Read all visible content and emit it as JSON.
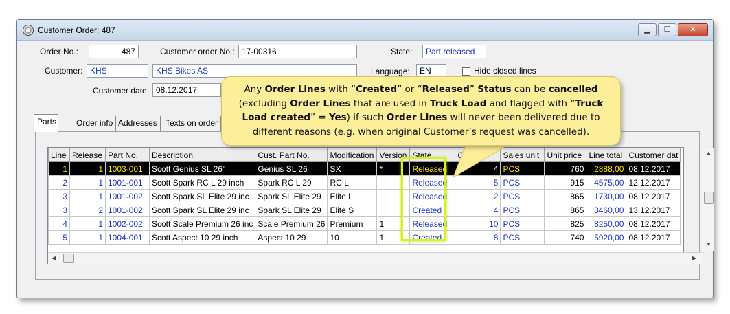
{
  "window": {
    "title": "Customer Order: 487"
  },
  "header": {
    "order_no_label": "Order No.:",
    "order_no": "487",
    "customer_order_no_label": "Customer order No.:",
    "customer_order_no": "17-00316",
    "state_label": "State:",
    "state": "Part.released",
    "customer_label": "Customer:",
    "customer_code": "KHS",
    "customer_name": "KHS Bikes AS",
    "language_label": "Language:",
    "language": "EN",
    "hide_closed_label": "Hide closed lines",
    "customer_date_label": "Customer date:",
    "customer_date": "08.12.2017"
  },
  "tabs": [
    "Parts",
    "Order info",
    "Addresses",
    "Texts on order"
  ],
  "grid": {
    "columns": [
      "Line",
      "Release",
      "Part No.",
      "Description",
      "Cust. Part No.",
      "Modification",
      "Version",
      "State",
      "Qty",
      "Sales unit",
      "Unit price",
      "Line total",
      "Customer dat"
    ],
    "rows": [
      {
        "line": "1",
        "release": "1",
        "part_no": "1003-001",
        "description": "Scott Genius SL 26\"",
        "cust_part_no": "Genius SL 26",
        "modification": "SX",
        "version": "*",
        "state": "Released",
        "qty": "4",
        "unit": "PCS",
        "unit_price": "760",
        "line_total": "2888,00",
        "customer_date": "08.12.2017"
      },
      {
        "line": "2",
        "release": "1",
        "part_no": "1001-001",
        "description": "Scott Spark RC L 29 inch",
        "cust_part_no": "Spark RC L 29",
        "modification": "RC L",
        "version": "",
        "state": "Released",
        "qty": "5",
        "unit": "PCS",
        "unit_price": "915",
        "line_total": "4575,00",
        "customer_date": "12.12.2017"
      },
      {
        "line": "3",
        "release": "1",
        "part_no": "1001-002",
        "description": "Scott Spark SL Elite 29 inc",
        "cust_part_no": "Spark SL Elite 29",
        "modification": "Elite L",
        "version": "",
        "state": "Released",
        "qty": "2",
        "unit": "PCS",
        "unit_price": "865",
        "line_total": "1730,00",
        "customer_date": "08.12.2017"
      },
      {
        "line": "3",
        "release": "2",
        "part_no": "1001-002",
        "description": "Scott Spark SL Elite 29 inc",
        "cust_part_no": "Spark SL Elite 29",
        "modification": "Elite S",
        "version": "",
        "state": "Created",
        "qty": "4",
        "unit": "PCS",
        "unit_price": "865",
        "line_total": "3460,00",
        "customer_date": "13.12.2017"
      },
      {
        "line": "4",
        "release": "1",
        "part_no": "1002-002",
        "description": "Scott Scale Premium 26 inc",
        "cust_part_no": "Scale Premium 26",
        "modification": "Premium",
        "version": "1",
        "state": "Released",
        "qty": "10",
        "unit": "PCS",
        "unit_price": "825",
        "line_total": "8250,00",
        "customer_date": "08.12.2017"
      },
      {
        "line": "5",
        "release": "1",
        "part_no": "1004-001",
        "description": "Scott Aspect 10 29 inch",
        "cust_part_no": "Aspect 10 29",
        "modification": "10",
        "version": "1",
        "state": "Created",
        "qty": "8",
        "unit": "PCS",
        "unit_price": "740",
        "line_total": "5920,00",
        "customer_date": "08.12.2017"
      }
    ]
  },
  "callout": {
    "p1": "Any ",
    "b1": "Order Lines",
    "p2": " with “",
    "b2": "Created",
    "p3": "” or “",
    "b3": "Released",
    "p4": "” ",
    "b4": "Status",
    "p5": " can be ",
    "b5": "cancelled",
    "p6": "(excluding ",
    "b6": "Order Lines",
    "p7": " that are used in ",
    "b7": "Truck Load",
    "p8": " and flagged with “",
    "b8": "Truck Load created",
    "p9": "” = ",
    "b9": "Yes",
    "p10": ")  if such ",
    "b10": "Order Lines",
    "p11": " will never been delivered due to different reasons (e.g. when original Customer’s request was cancelled)."
  },
  "colors": {
    "highlight": "#d6f21b",
    "callout_bg": "#fdee9a",
    "link_blue": "#1d36c9"
  }
}
